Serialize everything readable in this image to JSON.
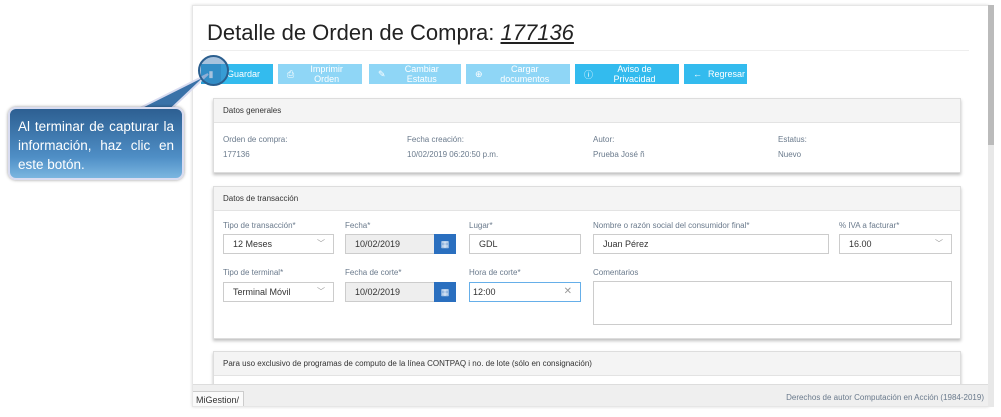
{
  "page": {
    "title_prefix": "Detalle de Orden de Compra: ",
    "order_number": "177136"
  },
  "toolbar": [
    {
      "label": "Guardar",
      "icon": "save-icon"
    },
    {
      "label": "Imprimir Orden",
      "icon": "print-icon"
    },
    {
      "label": "Cambiar Estatus",
      "icon": "edit-icon"
    },
    {
      "label": "Cargar documentos",
      "icon": "upload-icon"
    },
    {
      "label": "Aviso de Privacidad",
      "icon": "info-icon"
    },
    {
      "label": "Regresar",
      "icon": "arrow-left-icon"
    }
  ],
  "general": {
    "header": "Datos generales",
    "fields": [
      {
        "label": "Orden de compra:",
        "value": "177136"
      },
      {
        "label": "Fecha creación:",
        "value": "10/02/2019 06:20:50 p.m."
      },
      {
        "label": "Autor:",
        "value": "Prueba José ñ"
      },
      {
        "label": "Estatus:",
        "value": "Nuevo"
      }
    ]
  },
  "transaction": {
    "header": "Datos de transacción",
    "tipo_transaccion": {
      "label": "Tipo de transacción*",
      "value": "12 Meses"
    },
    "fecha": {
      "label": "Fecha*",
      "value": "10/02/2019"
    },
    "lugar": {
      "label": "Lugar*",
      "value": "GDL"
    },
    "nombre": {
      "label": "Nombre o razón social del consumidor final*",
      "value": "Juan Pérez"
    },
    "iva": {
      "label": "% IVA a facturar*",
      "value": "16.00"
    },
    "tipo_terminal": {
      "label": "Tipo de terminal*",
      "value": "Terminal Móvil"
    },
    "fecha_corte": {
      "label": "Fecha de corte*",
      "value": "10/02/2019"
    },
    "hora_corte": {
      "label": "Hora de corte*",
      "value": "12:00"
    },
    "comentarios": {
      "label": "Comentarios",
      "value": ""
    }
  },
  "lote": {
    "header": "Para uso exclusivo de programas de computo de la línea CONTPAQ i no. de lote (sólo en consignación)"
  },
  "footer": {
    "tab": "MiGestion/",
    "copyright": "Derechos de autor Computación en Acción (1984-2019)"
  },
  "callout": {
    "text": "Al terminar de capturar la información, haz clic en este botón."
  },
  "colors": {
    "primary": "#33bbee",
    "disabled": "#8fd6f6",
    "calendar": "#2a6fbf"
  }
}
